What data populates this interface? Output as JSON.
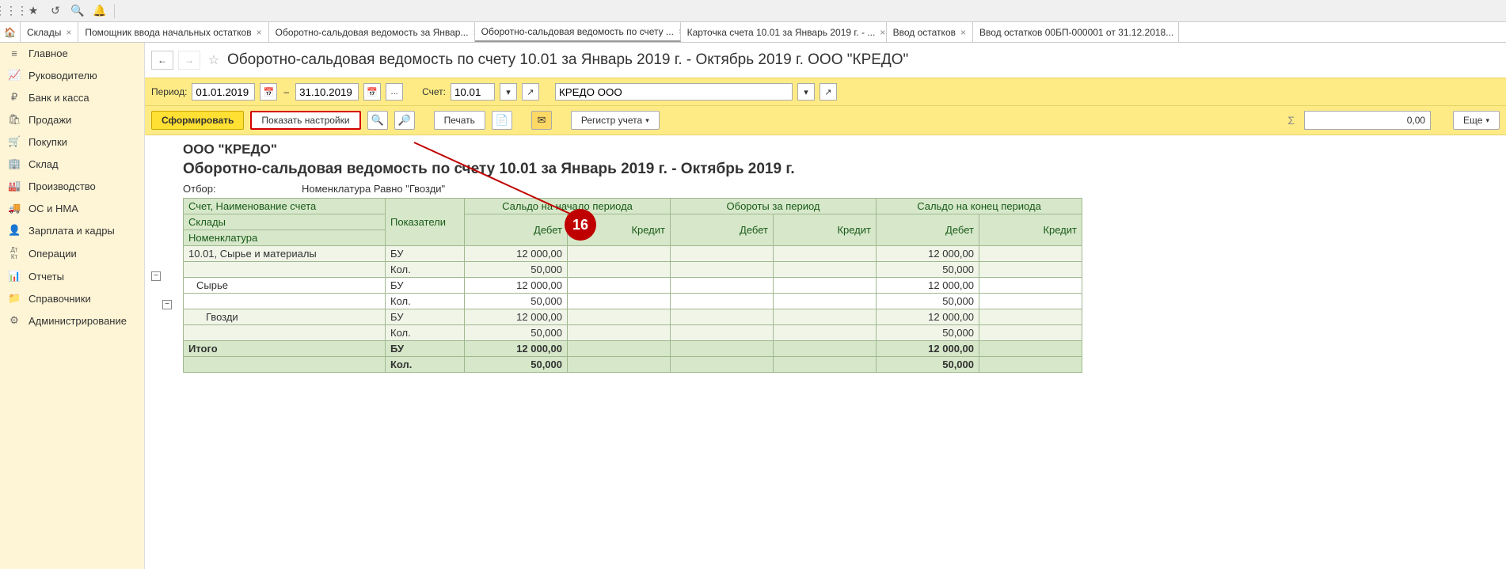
{
  "toolbar_icons": [
    "apps-icon",
    "star-icon",
    "history-icon",
    "search-icon",
    "bell-icon"
  ],
  "tabs": [
    {
      "label": "Склады",
      "active": false
    },
    {
      "label": "Помощник ввода начальных остатков",
      "active": false
    },
    {
      "label": "Оборотно-сальдовая ведомость за Январ...",
      "active": false
    },
    {
      "label": "Оборотно-сальдовая ведомость по счету ...",
      "active": true
    },
    {
      "label": "Карточка счета 10.01 за Январь 2019 г. - ...",
      "active": false
    },
    {
      "label": "Ввод остатков",
      "active": false
    },
    {
      "label": "Ввод остатков 00БП-000001 от 31.12.2018...",
      "active": false
    }
  ],
  "sidebar": {
    "items": [
      {
        "icon": "≡",
        "label": "Главное"
      },
      {
        "icon": "📈",
        "label": "Руководителю"
      },
      {
        "icon": "₽",
        "label": "Банк и касса"
      },
      {
        "icon": "🛍",
        "label": "Продажи"
      },
      {
        "icon": "🛒",
        "label": "Покупки"
      },
      {
        "icon": "🏢",
        "label": "Склад"
      },
      {
        "icon": "🏭",
        "label": "Производство"
      },
      {
        "icon": "🚚",
        "label": "ОС и НМА"
      },
      {
        "icon": "👤",
        "label": "Зарплата и кадры"
      },
      {
        "icon": "Дт Кт",
        "label": "Операции"
      },
      {
        "icon": "📊",
        "label": "Отчеты"
      },
      {
        "icon": "📁",
        "label": "Справочники"
      },
      {
        "icon": "⚙",
        "label": "Администрирование"
      }
    ]
  },
  "page": {
    "title": "Оборотно-сальдовая ведомость по счету 10.01 за Январь 2019 г. - Октябрь 2019 г. ООО \"КРЕДО\"",
    "period_label": "Период:",
    "date_from": "01.01.2019",
    "date_to": "31.10.2019",
    "account_label": "Счет:",
    "account": "10.01",
    "org": "КРЕДО ООО",
    "btn_generate": "Сформировать",
    "btn_settings": "Показать настройки",
    "btn_print": "Печать",
    "btn_register": "Регистр учета",
    "btn_more": "Еще",
    "sum_value": "0,00",
    "sigma": "Σ"
  },
  "report": {
    "company": "ООО \"КРЕДО\"",
    "title": "Оборотно-сальдовая ведомость по счету 10.01 за Январь 2019 г. - Октябрь 2019 г.",
    "filter_label": "Отбор:",
    "filter_value": "Номенклатура Равно \"Гвозди\"",
    "headers": {
      "acct": "Счет, Наименование счета",
      "indicators": "Показатели",
      "start": "Сальдо на начало периода",
      "turnover": "Обороты за период",
      "end": "Сальдо на конец периода",
      "debit": "Дебет",
      "credit": "Кредит",
      "store": "Склады",
      "nomen": "Номенклатура"
    },
    "rows": [
      {
        "label": "10.01, Сырье и материалы",
        "ind": "БУ",
        "sd": "12 000,00",
        "sc": "",
        "td": "",
        "tc": "",
        "ed": "12 000,00",
        "ec": "",
        "cls": "striped",
        "indent": 0
      },
      {
        "label": "",
        "ind": "Кол.",
        "sd": "50,000",
        "sc": "",
        "td": "",
        "tc": "",
        "ed": "50,000",
        "ec": "",
        "cls": "striped",
        "indent": 0
      },
      {
        "label": "Сырье",
        "ind": "БУ",
        "sd": "12 000,00",
        "sc": "",
        "td": "",
        "tc": "",
        "ed": "12 000,00",
        "ec": "",
        "cls": "",
        "indent": 1
      },
      {
        "label": "",
        "ind": "Кол.",
        "sd": "50,000",
        "sc": "",
        "td": "",
        "tc": "",
        "ed": "50,000",
        "ec": "",
        "cls": "",
        "indent": 1
      },
      {
        "label": "Гвозди",
        "ind": "БУ",
        "sd": "12 000,00",
        "sc": "",
        "td": "",
        "tc": "",
        "ed": "12 000,00",
        "ec": "",
        "cls": "striped",
        "indent": 2
      },
      {
        "label": "",
        "ind": "Кол.",
        "sd": "50,000",
        "sc": "",
        "td": "",
        "tc": "",
        "ed": "50,000",
        "ec": "",
        "cls": "striped",
        "indent": 2
      }
    ],
    "total": {
      "label": "Итого",
      "ind1": "БУ",
      "sd1": "12 000,00",
      "ed1": "12 000,00",
      "ind2": "Кол.",
      "sd2": "50,000",
      "ed2": "50,000"
    }
  },
  "annotation": {
    "number": "16"
  }
}
